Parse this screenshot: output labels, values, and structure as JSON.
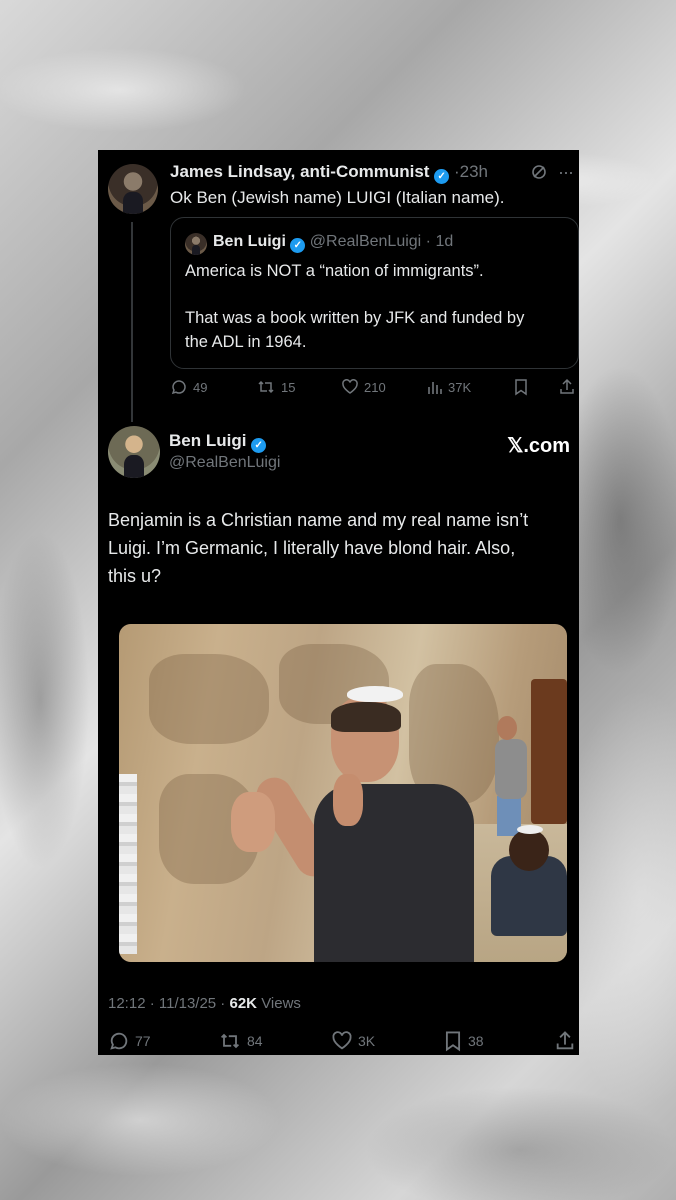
{
  "tweet1": {
    "author_name": "James Lindsay, anti-Communist",
    "time": "23h",
    "text": "Ok Ben (Jewish name) LUIGI (Italian name).",
    "quoted": {
      "author_name": "Ben Luigi",
      "handle": "@RealBenLuigi",
      "time": "1d",
      "line1": "America is NOT a “nation of immigrants”.",
      "line2": "That was a book written by JFK and funded by",
      "line3": "the ADL in 1964."
    },
    "replies": "49",
    "reposts": "15",
    "likes": "210",
    "views": "37K"
  },
  "tweet2": {
    "author_name": "Ben Luigi",
    "handle": "@RealBenLuigi",
    "site_label": "𝕏.com",
    "text_line1": "Benjamin is a Christian name and my real name isn’t",
    "text_line2": "Luigi. I’m Germanic, I literally have blond hair. Also,",
    "text_line3": "this u?",
    "timestamp": "12:12 · 11/13/25 ·",
    "views_count": "62K",
    "views_label": "Views",
    "replies": "77",
    "reposts": "84",
    "likes": "3K",
    "bookmarks": "38"
  },
  "colors": {
    "verified": "#1d9bf0",
    "text": "#e7e9ea",
    "muted": "#71767b",
    "card_bg": "#000000"
  },
  "icons": [
    "grok-icon",
    "more-icon",
    "reply-icon",
    "repost-icon",
    "like-icon",
    "views-icon",
    "bookmark-icon",
    "share-icon",
    "verified-badge-icon"
  ]
}
